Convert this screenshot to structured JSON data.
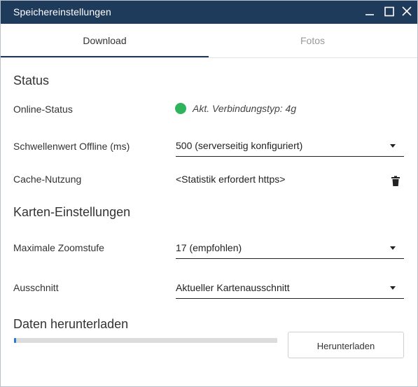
{
  "window": {
    "title": "Speichereinstellungen"
  },
  "tabs": [
    {
      "label": "Download",
      "active": true
    },
    {
      "label": "Fotos",
      "active": false
    }
  ],
  "status": {
    "heading": "Status",
    "online_label": "Online-Status",
    "online_value": "Akt. Verbindungstyp: 4g",
    "online_color": "#2fb35c",
    "threshold_label": "Schwellenwert Offline (ms)",
    "threshold_value": "500 (serverseitig konfiguriert)",
    "cache_label": "Cache-Nutzung",
    "cache_value": "<Statistik erfordert https>"
  },
  "map_settings": {
    "heading": "Karten-Einstellungen",
    "zoom_label": "Maximale Zoomstufe",
    "zoom_value": "17 (empfohlen)",
    "extent_label": "Ausschnitt",
    "extent_value": "Aktueller Kartenausschnitt"
  },
  "download": {
    "heading": "Daten herunterladen",
    "progress_fraction": 0.005,
    "button_label": "Herunterladen"
  },
  "colors": {
    "titlebar": "#1f3b5c",
    "accent": "#2a7ad1"
  }
}
